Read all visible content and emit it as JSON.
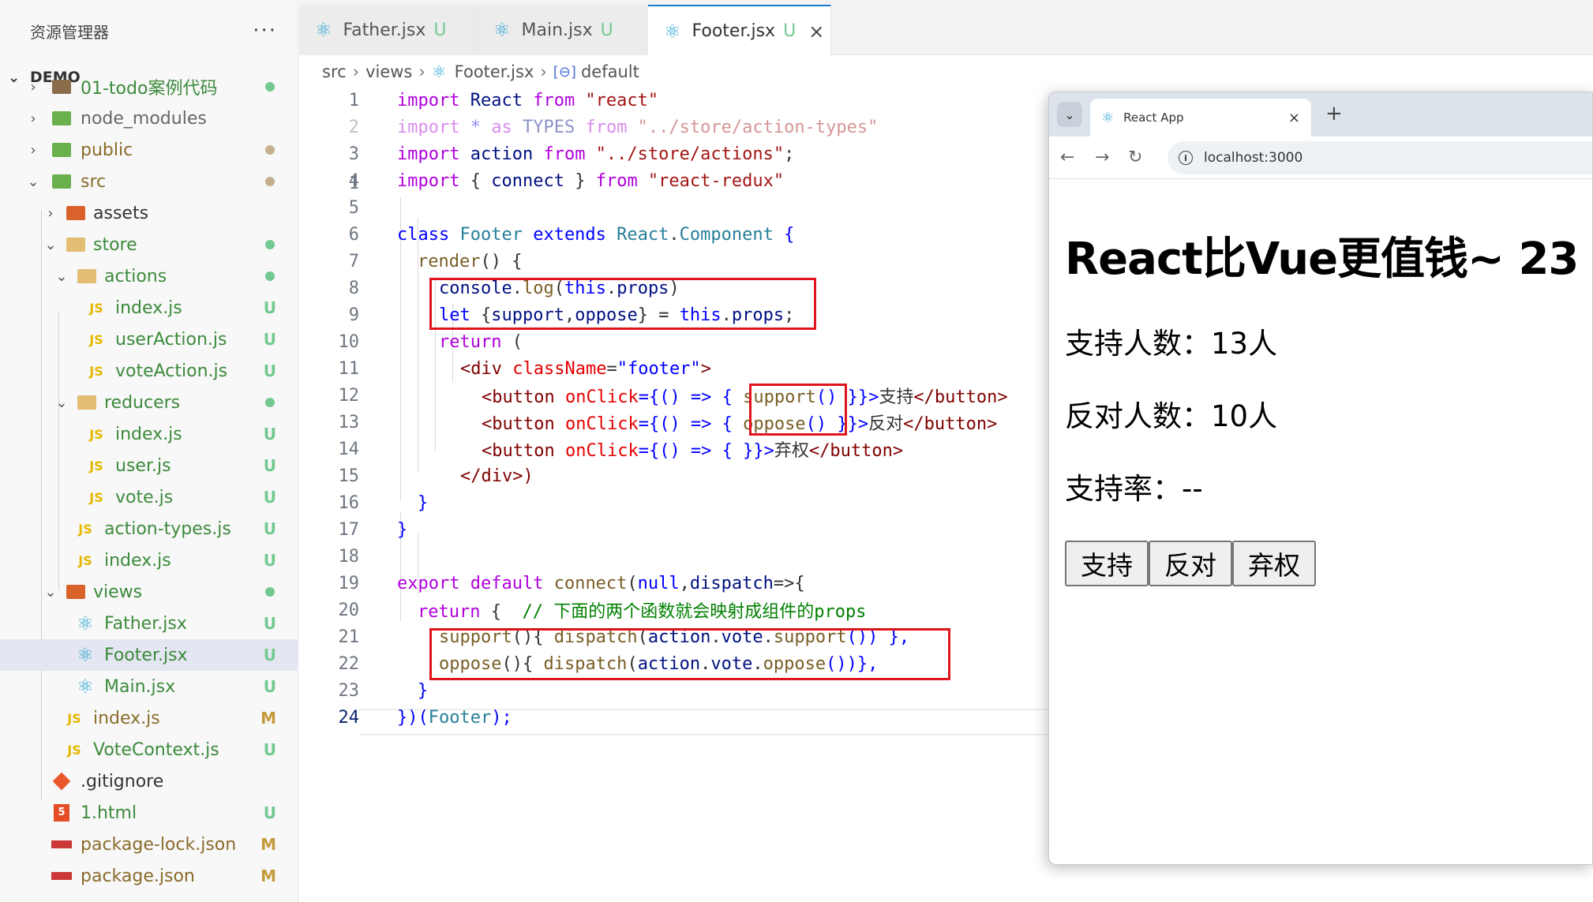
{
  "sidebar": {
    "title": "资源管理器",
    "more": "···",
    "root": "DEMO",
    "items": [
      {
        "name": "01-todo案例代码",
        "status": "dot-green"
      },
      {
        "name": "node_modules",
        "status": ""
      },
      {
        "name": "public",
        "status": "dot-tan"
      },
      {
        "name": "src",
        "status": "dot-tan"
      },
      {
        "name": "assets",
        "status": ""
      },
      {
        "name": "store",
        "status": "dot-green"
      },
      {
        "name": "actions",
        "status": "dot-green"
      },
      {
        "name": "index.js",
        "status": "U"
      },
      {
        "name": "userAction.js",
        "status": "U"
      },
      {
        "name": "voteAction.js",
        "status": "U"
      },
      {
        "name": "reducers",
        "status": "dot-green"
      },
      {
        "name": "index.js",
        "status": "U"
      },
      {
        "name": "user.js",
        "status": "U"
      },
      {
        "name": "vote.js",
        "status": "U"
      },
      {
        "name": "action-types.js",
        "status": "U"
      },
      {
        "name": "index.js",
        "status": "U"
      },
      {
        "name": "views",
        "status": "dot-green"
      },
      {
        "name": "Father.jsx",
        "status": "U"
      },
      {
        "name": "Footer.jsx",
        "status": "U"
      },
      {
        "name": "Main.jsx",
        "status": "U"
      },
      {
        "name": "index.js",
        "status": "M"
      },
      {
        "name": "VoteContext.js",
        "status": "U"
      },
      {
        "name": ".gitignore",
        "status": ""
      },
      {
        "name": "1.html",
        "status": "U"
      },
      {
        "name": "package-lock.json",
        "status": "M"
      },
      {
        "name": "package.json",
        "status": "M"
      }
    ]
  },
  "tabs": [
    {
      "label": "Father.jsx",
      "status": "U"
    },
    {
      "label": "Main.jsx",
      "status": "U"
    },
    {
      "label": "Footer.jsx",
      "status": "U",
      "close": "×"
    }
  ],
  "breadcrumb": {
    "a": "src",
    "b": "views",
    "c": "Footer.jsx",
    "d": "default"
  },
  "editor": {
    "lines": [
      "1",
      "2",
      "3",
      "4",
      "5",
      "6",
      "7",
      "8",
      "9",
      "10",
      "11",
      "12",
      "13",
      "14",
      "15",
      "16",
      "17",
      "18",
      "19",
      "20",
      "21",
      "22",
      "23",
      "24"
    ],
    "code": {
      "l1": {
        "a": "import",
        "b": " React ",
        "c": "from",
        "d": " \"react\""
      },
      "l2": {
        "a": "import",
        "b": " * ",
        "c": "as",
        "d": " TYPES ",
        "e": "from",
        "f": " \"../store/action-types\""
      },
      "l3": {
        "a": "import",
        "b": " action ",
        "c": "from",
        "d": " \"../store/actions\"",
        "e": ";"
      },
      "l4": {
        "a": "import",
        "b": " { ",
        "c": "connect",
        "d": " } ",
        "e": "from",
        "f": " \"react-redux\""
      },
      "l6": {
        "a": "class",
        "b": " Footer ",
        "c": "extends",
        "d": " React",
        "e": ".",
        "f": "Component",
        "g": " {"
      },
      "l7": {
        "a": "render",
        "b": "() {"
      },
      "l8": {
        "a": "console",
        "b": ".",
        "c": "log",
        "d": "(",
        "e": "this",
        "f": ".",
        "g": "props",
        "h": ")"
      },
      "l9": {
        "a": "let",
        "b": " {",
        "c": "support",
        "d": ",",
        "e": "oppose",
        "f": "} = ",
        "g": "this",
        "h": ".",
        "i": "props",
        "j": ";"
      },
      "l10": {
        "a": "return",
        "b": " ("
      },
      "l11": {
        "a": "<",
        "b": "div",
        "c": " ",
        "d": "className",
        "e": "=",
        "f": "\"footer\"",
        "g": ">"
      },
      "l12": {
        "a": "<",
        "b": "button",
        "c": " ",
        "d": "onClick",
        "e": "={() => { ",
        "f": "support",
        "g": "() }}>",
        "h": "支持",
        "i": "</",
        "j": "button",
        "k": ">"
      },
      "l13": {
        "a": "<",
        "b": "button",
        "c": " ",
        "d": "onClick",
        "e": "={() => { ",
        "f": "oppose",
        "g": "() }}>",
        "h": "反对",
        "i": "</",
        "j": "button",
        "k": ">"
      },
      "l14": {
        "a": "<",
        "b": "button",
        "c": " ",
        "d": "onClick",
        "e": "={() => { }}>",
        "h": "弃权",
        "i": "</",
        "j": "button",
        "k": ">"
      },
      "l15": {
        "a": "</",
        "b": "div",
        "c": ">)"
      },
      "l16": {
        "a": "}"
      },
      "l17": {
        "a": "}"
      },
      "l19": {
        "a": "export",
        "b": " ",
        "c": "default",
        "d": " ",
        "e": "connect",
        "f": "(",
        "g": "null",
        "h": ",",
        "i": "dispatch",
        "j": "=>{"
      },
      "l20": {
        "a": "return",
        "b": " {  ",
        "c": "// 下面的两个函数就会映射成组件的props"
      },
      "l21": {
        "a": "support",
        "b": "(){ ",
        "c": "dispatch",
        "d": "(",
        "e": "action",
        "f": ".",
        "g": "vote",
        "h": ".",
        "i": "support",
        "j": "()) },"
      },
      "l22": {
        "a": "oppose",
        "b": "(){ ",
        "c": "dispatch",
        "d": "(",
        "e": "action",
        "f": ".",
        "g": "vote",
        "h": ".",
        "i": "oppose",
        "j": "())},"
      },
      "l23": {
        "a": "}"
      },
      "l24": {
        "a": "})(",
        "b": "Footer",
        "c": ");"
      }
    }
  },
  "browser": {
    "tab_title": "React App",
    "tab_close": "×",
    "new_tab": "+",
    "url": "localhost:3000",
    "heading": "React比Vue更值钱~ 23",
    "support_line": "支持人数：13人",
    "oppose_line": "反对人数：10人",
    "rate_line": "支持率：--",
    "buttons": {
      "support": "支持",
      "oppose": "反对",
      "abstain": "弃权"
    }
  },
  "colors": {
    "accent": "#1f7ad2",
    "untracked": "#73c991",
    "modified": "#c49a3c",
    "highlight_box": "#e0151b"
  }
}
